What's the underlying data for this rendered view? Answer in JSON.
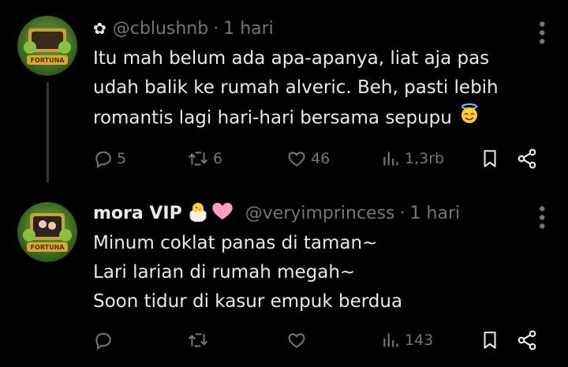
{
  "tweets": [
    {
      "display_name": "",
      "handle": "@cblushnb",
      "separator": "·",
      "time": "1 hari",
      "text": "Itu mah belum ada apa-apanya, liat aja pas\nudah balik ke rumah alveric. Beh, pasti lebih\nromantis lagi hari-hari bersama sepupu",
      "emoji": "halo-smile-emoji",
      "actions": {
        "replies": "5",
        "reposts": "6",
        "likes": "46",
        "views": "1,3rb"
      },
      "avatar_text": "FORTUNA"
    },
    {
      "display_name": "mora VIP",
      "handle": "@veryimprincess",
      "separator": "·",
      "time": "1 hari",
      "text": "Minum coklat panas di taman~\nLari larian di rumah megah~\nSoon tidur di kasur empuk berdua",
      "name_emojis": [
        "hatching-chick-emoji",
        "pink-heart-emoji"
      ],
      "actions": {
        "replies": "",
        "reposts": "",
        "likes": "",
        "views": "143"
      },
      "avatar_text": "FORTUNA"
    }
  ],
  "icons": [
    "flower-icon",
    "more-icon",
    "reply-icon",
    "repost-icon",
    "like-icon",
    "views-icon",
    "bookmark-icon",
    "share-icon"
  ],
  "colors": {
    "background": "#000000",
    "text": "#e7e9ea",
    "muted": "#71767b",
    "thread": "#333639"
  }
}
